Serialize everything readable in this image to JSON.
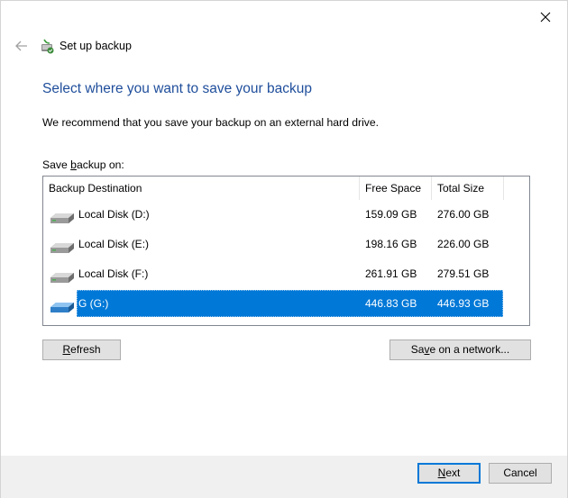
{
  "window": {
    "title": "Set up backup",
    "close_label": "Close"
  },
  "page": {
    "heading": "Select where you want to save your backup",
    "recommendation": "We recommend that you save your backup on an external hard drive.",
    "save_label_prefix": "Save ",
    "save_label_accel": "b",
    "save_label_suffix": "ackup on:"
  },
  "list": {
    "columns": [
      "Backup Destination",
      "Free Space",
      "Total Size"
    ],
    "rows": [
      {
        "name": "Local Disk (D:)",
        "free": "159.09 GB",
        "total": "276.00 GB",
        "icon": "hard-drive-icon",
        "selected": false
      },
      {
        "name": "Local Disk (E:)",
        "free": "198.16 GB",
        "total": "226.00 GB",
        "icon": "hard-drive-icon",
        "selected": false
      },
      {
        "name": "Local Disk (F:)",
        "free": "261.91 GB",
        "total": "279.51 GB",
        "icon": "hard-drive-icon",
        "selected": false
      },
      {
        "name": "G (G:)",
        "free": "446.83 GB",
        "total": "446.93 GB",
        "icon": "external-drive-icon",
        "selected": true
      }
    ]
  },
  "buttons": {
    "refresh_accel": "R",
    "refresh_rest": "efresh",
    "network_pre": "Sa",
    "network_accel": "v",
    "network_rest": "e on a network...",
    "next_accel": "N",
    "next_rest": "ext",
    "cancel": "Cancel"
  },
  "colors": {
    "heading": "#1f4e9b",
    "selection": "#0078d7",
    "footer": "#f0f0f0"
  }
}
